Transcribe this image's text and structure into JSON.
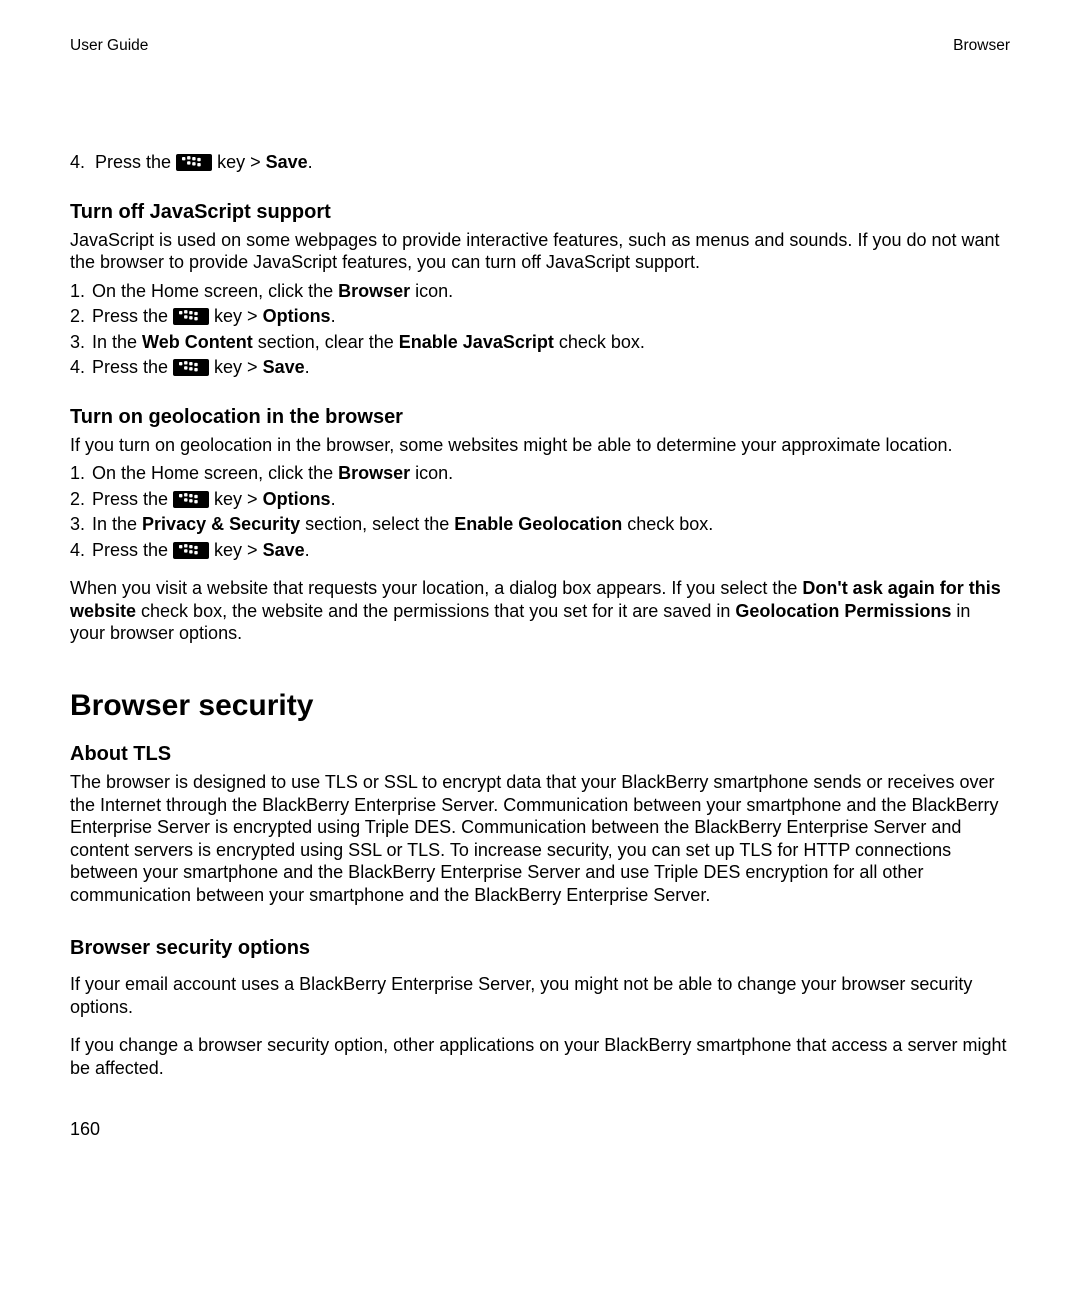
{
  "header": {
    "left": "User Guide",
    "right": "Browser"
  },
  "pageNumber": "160",
  "topStep": {
    "num": "4.",
    "before": "Press the ",
    "after1": " key > ",
    "bold": "Save",
    "after2": "."
  },
  "sec1": {
    "title": "Turn off JavaScript support",
    "intro": "JavaScript is used on some webpages to provide interactive features, such as menus and sounds. If you do not want the browser to provide JavaScript features, you can turn off JavaScript support.",
    "s1": {
      "num": "1.",
      "a": "On the Home screen, click the ",
      "b": "Browser",
      "c": " icon."
    },
    "s2": {
      "num": "2.",
      "a": "Press the ",
      "b": " key > ",
      "c": "Options",
      "d": "."
    },
    "s3": {
      "num": "3.",
      "a": "In the ",
      "b": "Web Content",
      "c": " section, clear the ",
      "d": "Enable JavaScript",
      "e": " check box."
    },
    "s4": {
      "num": "4.",
      "a": "Press the ",
      "b": " key > ",
      "c": "Save",
      "d": "."
    }
  },
  "sec2": {
    "title": "Turn on geolocation in the browser",
    "intro": "If you turn on geolocation in the browser, some websites might be able to determine your approximate location.",
    "s1": {
      "num": "1.",
      "a": "On the Home screen, click the ",
      "b": "Browser",
      "c": " icon."
    },
    "s2": {
      "num": "2.",
      "a": "Press the ",
      "b": " key > ",
      "c": "Options",
      "d": "."
    },
    "s3": {
      "num": "3.",
      "a": "In the ",
      "b": "Privacy & Security",
      "c": " section, select the ",
      "d": "Enable Geolocation",
      "e": " check box."
    },
    "s4": {
      "num": "4.",
      "a": "Press the ",
      "b": " key > ",
      "c": "Save",
      "d": "."
    },
    "note": {
      "a": "When you visit a website that requests your location, a dialog box appears. If you select the ",
      "b": "Don't ask again for this website",
      "c": " check box, the website and the permissions that you set for it are saved in ",
      "d": "Geolocation Permissions",
      "e": " in your browser options."
    }
  },
  "bigHeading": "Browser security",
  "sec3": {
    "title": "About TLS",
    "body": "The browser is designed to use TLS or SSL to encrypt data that your BlackBerry smartphone sends or receives over the Internet through the BlackBerry Enterprise Server. Communication between your smartphone and the BlackBerry Enterprise Server is encrypted using Triple DES. Communication between the BlackBerry Enterprise Server and content servers is encrypted using SSL or TLS. To increase security, you can set up TLS for HTTP connections between your smartphone and the BlackBerry Enterprise Server and use Triple DES encryption for all other communication between your smartphone and the BlackBerry Enterprise Server."
  },
  "sec4": {
    "title": "Browser security options",
    "p1": "If your email account uses a BlackBerry Enterprise Server, you might not be able to change your browser security options.",
    "p2": "If you change a browser security option, other applications on your BlackBerry smartphone that access a server might be affected."
  }
}
